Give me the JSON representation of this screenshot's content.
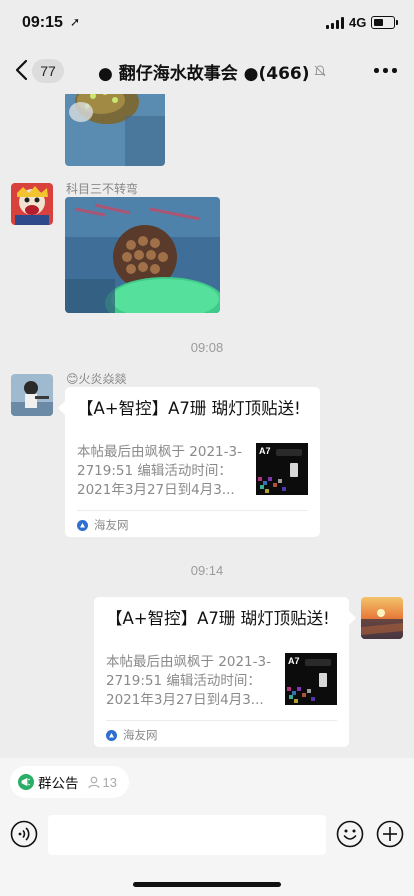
{
  "status_bar": {
    "time": "09:15",
    "network": "4G"
  },
  "nav": {
    "unread_count": "77",
    "title": "● 翻仔海水故事会 ●(466)"
  },
  "messages": {
    "sender_2": "科目三不转弯",
    "timestamp_1": "09:08",
    "sender_3_emoji": "😊",
    "sender_3_name": "火炎焱燚",
    "card_1": {
      "title": "【A+智控】A7珊 瑚灯顶贴送!",
      "desc": "本帖最后由飒枫于 2021-3-2719:51 编辑活动时间：2021年3月27日到4月3...",
      "source": "海友网",
      "thumb_label": "A7"
    },
    "timestamp_2": "09:14",
    "card_2": {
      "title": "【A+智控】A7珊 瑚灯顶贴送!",
      "desc": "本帖最后由飒枫于 2021-3-2719:51 编辑活动时间：2021年3月27日到4月3...",
      "source": "海友网",
      "thumb_label": "A7"
    }
  },
  "notice_bar": {
    "label": "群公告",
    "count": "13"
  },
  "colors": {
    "accent": "#2aae67",
    "chat_bg": "#ededed",
    "card_bg": "#ffffff",
    "source_icon": "#2e6fd0"
  }
}
